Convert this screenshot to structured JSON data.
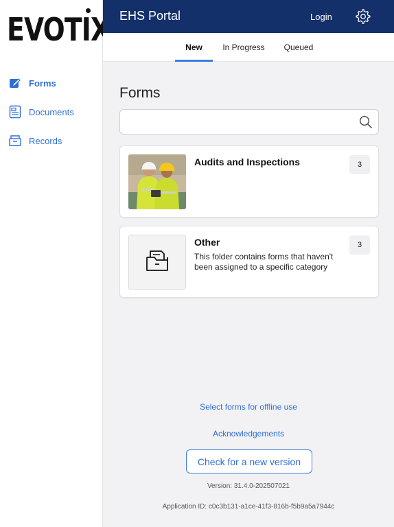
{
  "brand": {
    "logo_text": "EVOTIX"
  },
  "sidebar": {
    "items": [
      {
        "label": "Forms",
        "icon": "edit-icon",
        "active": true
      },
      {
        "label": "Documents",
        "icon": "document-icon",
        "active": false
      },
      {
        "label": "Records",
        "icon": "records-icon",
        "active": false
      }
    ]
  },
  "header": {
    "title": "EHS Portal",
    "login_label": "Login",
    "settings_icon": "gear-icon"
  },
  "tabs": [
    {
      "label": "New",
      "active": true
    },
    {
      "label": "In Progress",
      "active": false
    },
    {
      "label": "Queued",
      "active": false
    }
  ],
  "main": {
    "title": "Forms",
    "search": {
      "placeholder": "",
      "value": ""
    },
    "folders": [
      {
        "title": "Audits and Inspections",
        "description": "",
        "count": "3",
        "thumb": "photo-workers"
      },
      {
        "title": "Other",
        "description": "This folder contains forms that haven't been assigned to a specific category",
        "count": "3",
        "thumb": "folder-icon"
      }
    ]
  },
  "footer": {
    "offline_link": "Select forms for offline use",
    "ack_link": "Acknowledgements",
    "check_button": "Check for a new version",
    "version": "Version: 31.4.0-202507021",
    "app_id": "Application ID: c0c3b131-a1ce-41f3-816b-f5b9a5a7944c"
  },
  "colors": {
    "header_bg": "#13306b",
    "accent": "#3c7be3",
    "link": "#2f6fd6",
    "main_bg": "#f2f2f4"
  }
}
